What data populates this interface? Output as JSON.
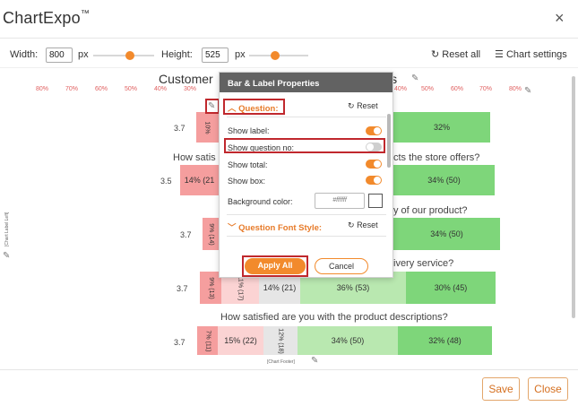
{
  "window": {
    "title": "ChartExpo",
    "title_mark": "™",
    "close_glyph": "×"
  },
  "toolbar": {
    "width_label": "Width:",
    "width_value": "800",
    "width_unit": "px",
    "height_label": "Height:",
    "height_value": "525",
    "height_unit": "px",
    "reset_all_label": "Reset all",
    "chart_settings_label": "Chart settings"
  },
  "chart": {
    "title_start": "Customer",
    "title_end": "is",
    "left_ticks": [
      "80%",
      "70%",
      "60%",
      "50%",
      "40%",
      "30%"
    ],
    "right_ticks": [
      "40%",
      "50%",
      "60%",
      "70%",
      "80%"
    ],
    "left_edge_label": "[Chart Label Left]",
    "footer_label": "[Chart Footer]",
    "rows": [
      {
        "total": "3.7",
        "question": "",
        "seg_dneg": "10%",
        "seg_dpos": "32%"
      },
      {
        "total": "3.5",
        "question": "How satis",
        "question_end": "cts the store offers?",
        "seg_dneg": "14% (21",
        "seg_dpos": "34% (50)"
      },
      {
        "total": "3.7",
        "question": "",
        "question_end": "y of our product?",
        "seg_dneg": "9% (14)",
        "seg_dpos": "34% (50)"
      },
      {
        "total": "3.7",
        "question": "",
        "question_end": "ivery service?",
        "seg_dneg": "9% (13)",
        "seg_neg": "11% (17)",
        "seg_neu": "14% (21)",
        "seg_pos": "36% (53)",
        "seg_dpos": "30% (45)"
      },
      {
        "total": "3.7",
        "question": "How satisfied are you with the product descriptions?",
        "seg_dneg": "7% (11)",
        "seg_neg": "15% (22)",
        "seg_neu": "12% (18)",
        "seg_pos": "34% (50)",
        "seg_dpos": "32% (48)"
      }
    ]
  },
  "panel": {
    "title": "Bar & Label Properties",
    "section_question": "Question:",
    "reset_label": "Reset",
    "show_label": "Show label:",
    "show_question_no": "Show question no:",
    "show_total": "Show total:",
    "show_box": "Show box:",
    "background_color_label": "Background color:",
    "background_color_value": "#ffffff",
    "section_font_style": "Question Font Style:",
    "font_style_reset": "Reset",
    "toggles": {
      "show_label": "on",
      "show_question_no": "off",
      "show_total": "on",
      "show_box": "on"
    },
    "apply_all": "Apply All",
    "cancel": "Cancel"
  },
  "footer": {
    "save_label": "Save",
    "close_label": "Close"
  },
  "colors": {
    "accent": "#f28a2c",
    "highlight": "#c0282d",
    "very_negative": "#f59e9e",
    "negative": "#fbd3d3",
    "neutral": "#e6e6e6",
    "positive": "#b9e8b0",
    "very_positive": "#7ed67a"
  }
}
